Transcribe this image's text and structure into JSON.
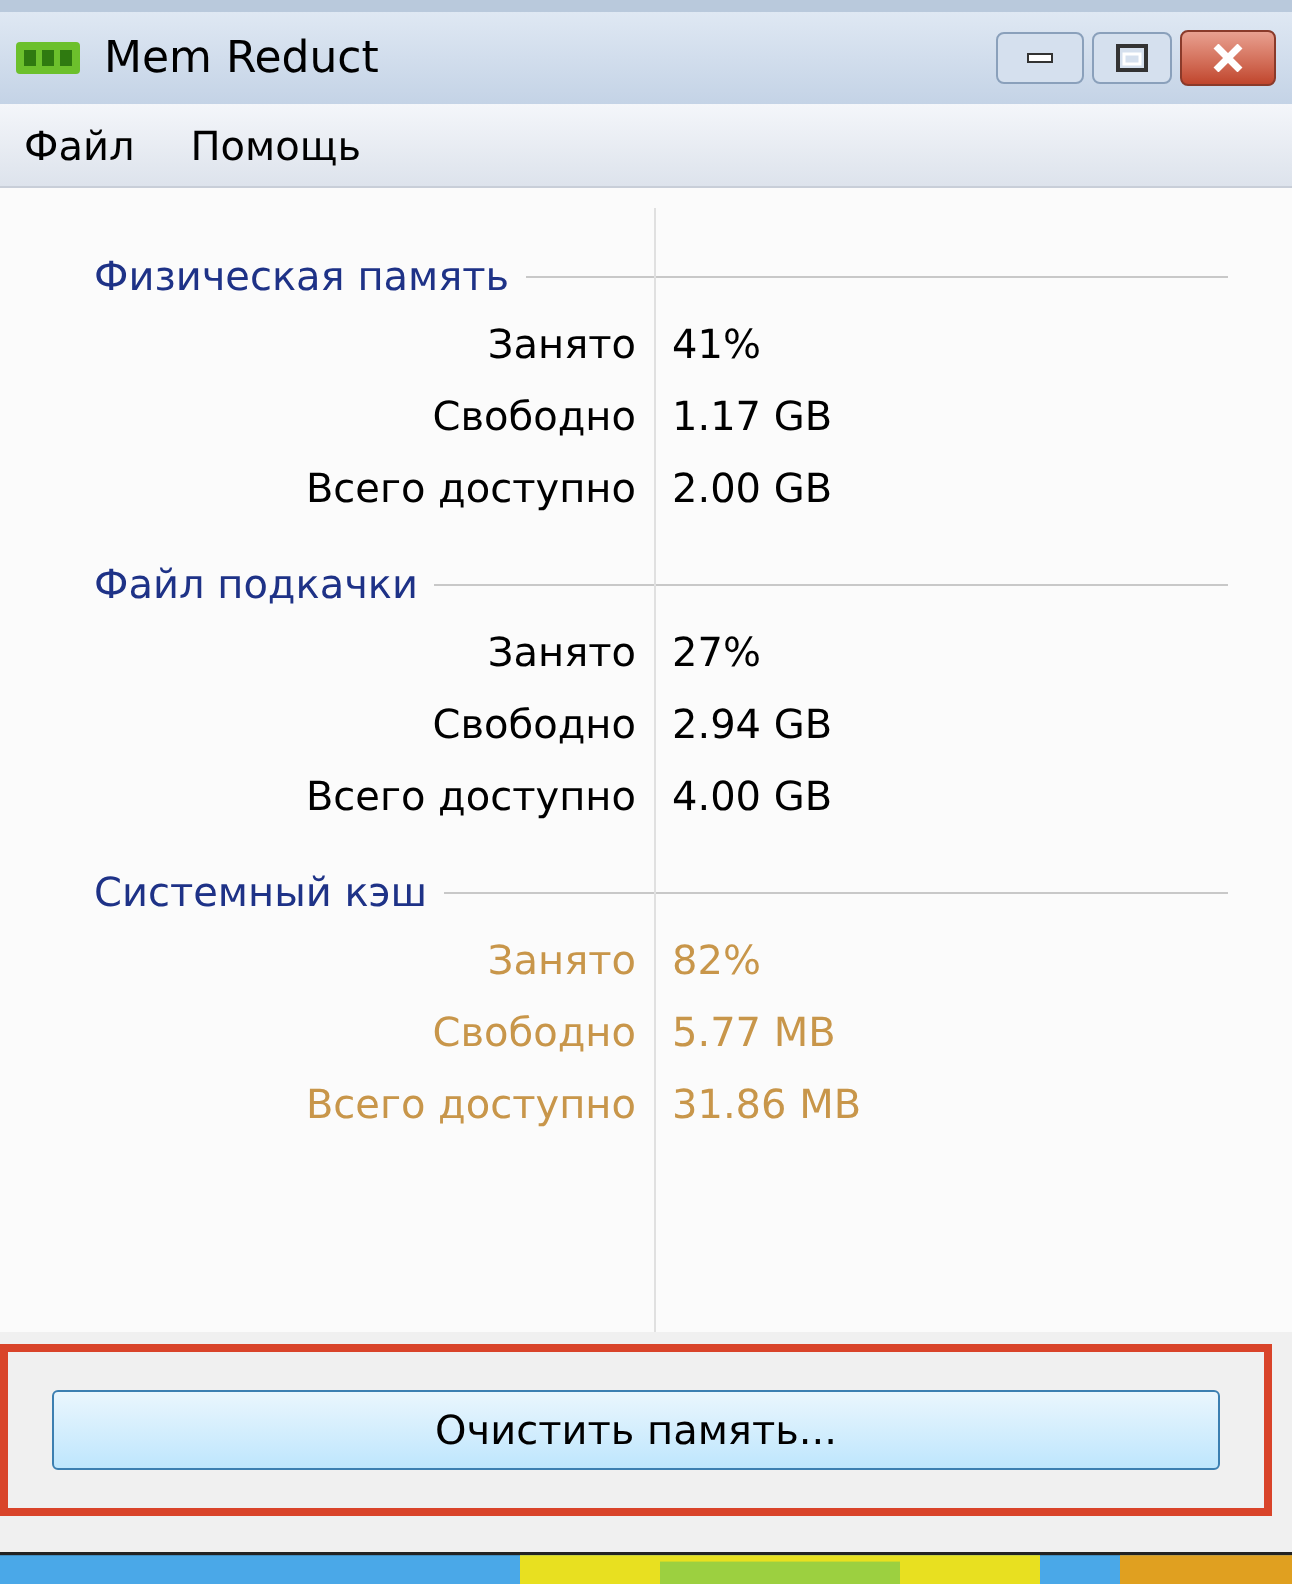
{
  "window": {
    "title": "Mem Reduct"
  },
  "menu": [
    "Файл",
    "Помощь"
  ],
  "sections": [
    {
      "title": "Физическая память",
      "rows": [
        {
          "label": "Занято",
          "value": "41%",
          "color": "#000000"
        },
        {
          "label": "Свободно",
          "value": "1.17 GB",
          "color": "#000000"
        },
        {
          "label": "Всего доступно",
          "value": "2.00 GB",
          "color": "#000000"
        }
      ]
    },
    {
      "title": "Файл подкачки",
      "rows": [
        {
          "label": "Занято",
          "value": "27%",
          "color": "#000000"
        },
        {
          "label": "Свободно",
          "value": "2.94 GB",
          "color": "#000000"
        },
        {
          "label": "Всего доступно",
          "value": "4.00 GB",
          "color": "#000000"
        }
      ]
    },
    {
      "title": "Системный кэш",
      "rows": [
        {
          "label": "Занято",
          "value": "82%",
          "color": "#c8964a"
        },
        {
          "label": "Свободно",
          "value": "5.77 MB",
          "color": "#c8964a"
        },
        {
          "label": "Всего доступно",
          "value": "31.86 MB",
          "color": "#c8964a"
        }
      ]
    }
  ],
  "button": {
    "label": "Очистить память...",
    "highlighted": true
  }
}
